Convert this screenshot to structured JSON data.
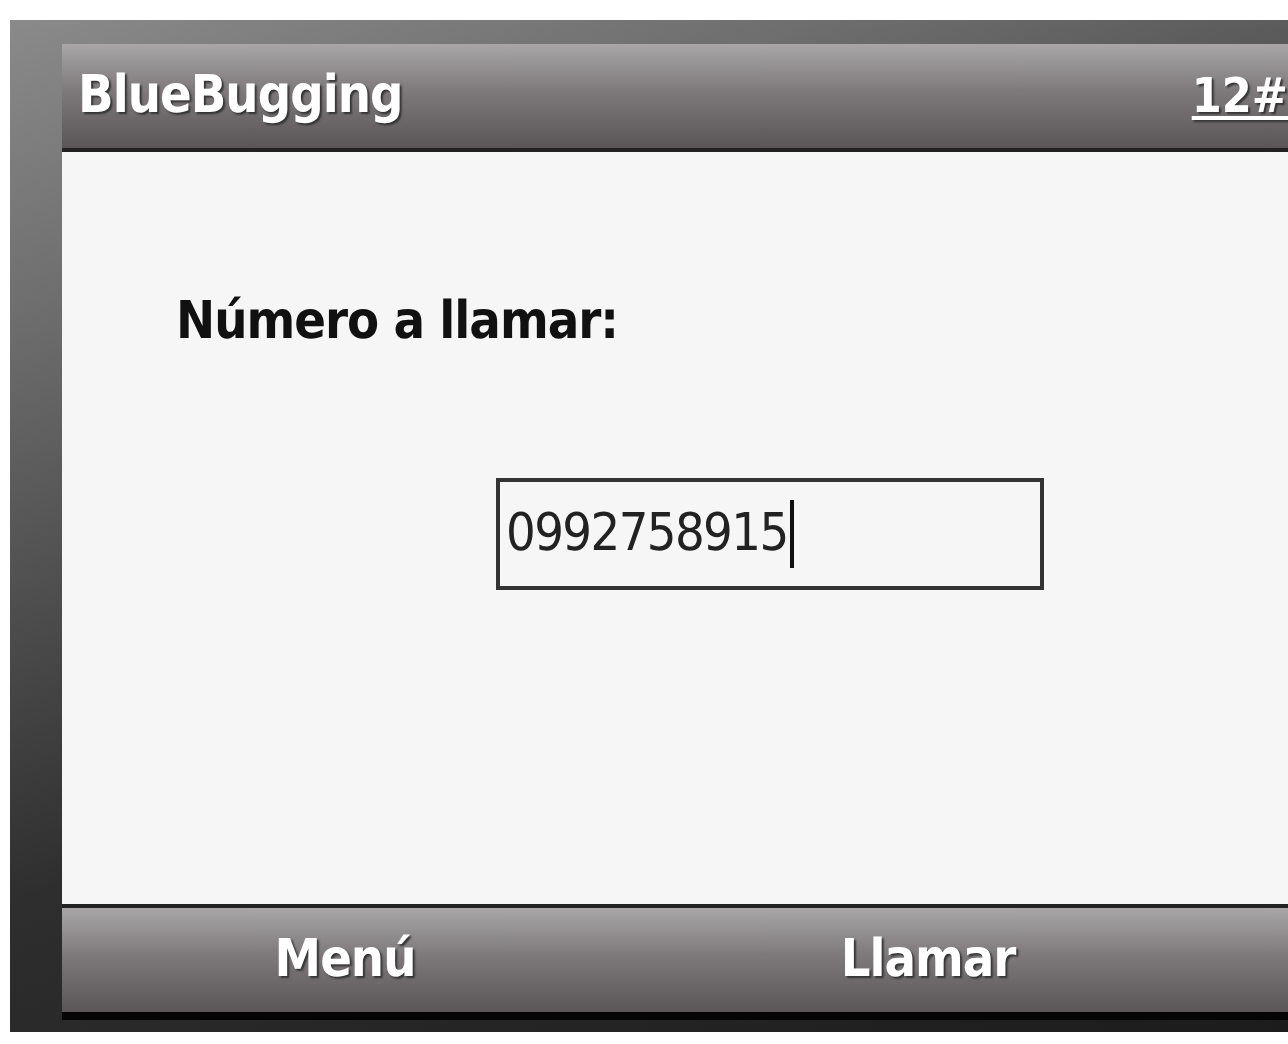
{
  "title_bar": {
    "title": "BlueBugging",
    "input_mode": "12#"
  },
  "form": {
    "label": "Número a llamar:",
    "field": {
      "value": "0992758915",
      "focused": true
    }
  },
  "soft_keys": [
    {
      "label": "Menú"
    },
    {
      "label": "Llamar"
    }
  ]
}
